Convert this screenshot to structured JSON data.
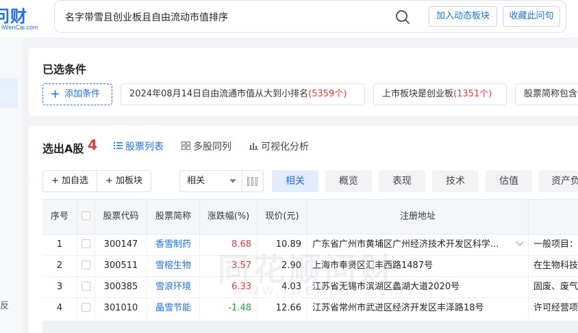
{
  "logo": {
    "mark": "问财",
    "sub": "iWenCai.com"
  },
  "search": {
    "query": "名字带雪且创业板且自由流动市值排序"
  },
  "header_buttons": {
    "add_dynamic": "加入动态板块",
    "favorite": "收藏此问句"
  },
  "rail": {
    "partial_char": "反"
  },
  "conditions": {
    "title": "已选条件",
    "add_label": "添加条件",
    "chips": [
      {
        "text": "2024年08月14日自由流通市值从大到小排名",
        "count": "(5359个)"
      },
      {
        "text": "上市板块是创业板",
        "count": "(1351个)"
      },
      {
        "text": "股票简称包含",
        "count": ""
      }
    ]
  },
  "results": {
    "title": "选出A股",
    "count": "4",
    "view_tabs": [
      {
        "label": "股票列表",
        "icon": "list-icon"
      },
      {
        "label": "多股同列",
        "icon": "grid-icon"
      },
      {
        "label": "可视化分析",
        "icon": "bar-chart-icon"
      }
    ],
    "add_watchlist": "加自选",
    "add_block": "加板块",
    "sort_select": "相关",
    "segments": [
      "相关",
      "概览",
      "表现",
      "技术",
      "估值",
      "资产负"
    ],
    "columns": [
      "序号",
      "",
      "股票代码",
      "股票简称",
      "涨跌幅(%)",
      "现价(元)",
      "注册地址",
      ""
    ],
    "rows": [
      {
        "no": "1",
        "code": "300147",
        "name": "香雪制药",
        "change": "8.68",
        "price": "10.89",
        "address": "广东省广州市黄埔区广州经济技术开发区科学...",
        "scope": "一般项目："
      },
      {
        "no": "2",
        "code": "300511",
        "name": "雪榕生物",
        "change": "3.57",
        "price": "2.90",
        "address": "上海市奉贤区汇丰西路1487号",
        "scope": "在生物科技"
      },
      {
        "no": "3",
        "code": "300385",
        "name": "雪浪环境",
        "change": "6.33",
        "price": "4.03",
        "address": "江苏省无锡市滨湖区蠡湖大道2020号",
        "scope": "固废、废气"
      },
      {
        "no": "4",
        "code": "301010",
        "name": "晶雪节能",
        "change": "-1.48",
        "price": "12.66",
        "address": "江苏省常州市武进区经济开发区丰泽路18号",
        "scope": "许可经营项"
      }
    ]
  },
  "watermark": {
    "main": "同花顺问财",
    "sub": "www.iwencai.com"
  },
  "colors": {
    "accent": "#1f6fe5",
    "up": "#e03b3b",
    "down": "#2a9d3c"
  }
}
